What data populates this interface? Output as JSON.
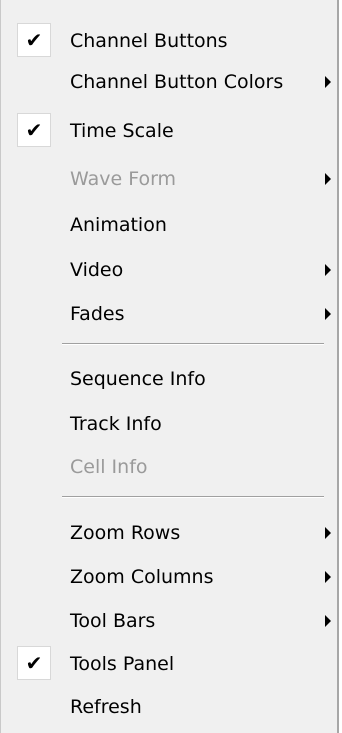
{
  "menu": {
    "items": [
      {
        "label": "Channel Buttons",
        "checked": true,
        "submenu": false,
        "enabled": true
      },
      {
        "label": "Channel Button Colors",
        "checked": false,
        "submenu": true,
        "enabled": true
      },
      {
        "label": "Time Scale",
        "checked": true,
        "submenu": false,
        "enabled": true
      },
      {
        "label": "Wave Form",
        "checked": false,
        "submenu": true,
        "enabled": false
      },
      {
        "label": "Animation",
        "checked": false,
        "submenu": false,
        "enabled": true
      },
      {
        "label": "Video",
        "checked": false,
        "submenu": true,
        "enabled": true
      },
      {
        "label": "Fades",
        "checked": false,
        "submenu": true,
        "enabled": true
      },
      {
        "label": "Sequence Info",
        "checked": false,
        "submenu": false,
        "enabled": true
      },
      {
        "label": "Track Info",
        "checked": false,
        "submenu": false,
        "enabled": true
      },
      {
        "label": "Cell Info",
        "checked": false,
        "submenu": false,
        "enabled": false
      },
      {
        "label": "Zoom Rows",
        "checked": false,
        "submenu": true,
        "enabled": true
      },
      {
        "label": "Zoom Columns",
        "checked": false,
        "submenu": true,
        "enabled": true
      },
      {
        "label": "Tool Bars",
        "checked": false,
        "submenu": true,
        "enabled": true
      },
      {
        "label": "Tools Panel",
        "checked": true,
        "submenu": false,
        "enabled": true
      },
      {
        "label": "Refresh",
        "checked": false,
        "submenu": false,
        "enabled": true
      }
    ],
    "check_glyph": "✔"
  }
}
